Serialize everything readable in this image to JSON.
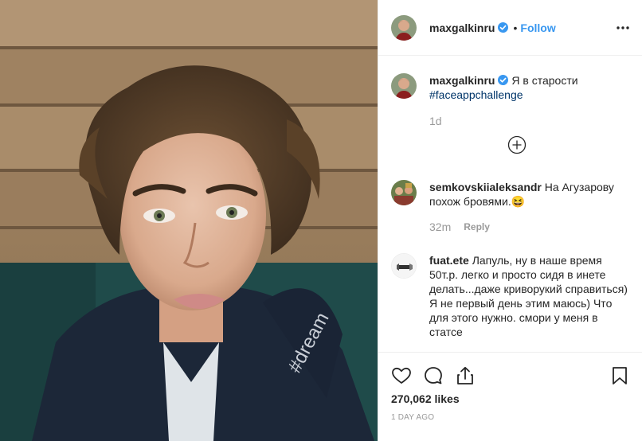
{
  "post": {
    "author": {
      "username": "maxgalkinru",
      "verified": true,
      "follow_label": "Follow",
      "separator": "•"
    },
    "caption": {
      "text": "Я в старости",
      "hashtag": "#faceappchallenge",
      "time": "1d"
    },
    "comments": [
      {
        "username": "semkovskiialeksandr",
        "text": "На Агузарову похож бровями.😆",
        "time": "32m",
        "reply_label": "Reply"
      },
      {
        "username": "fuat.ete",
        "text": "Лапуль, ну в наше время 50т.р. легко и просто сидя в инете делать...даже криворукий справиться) Я не первый день этим маюсь) Что для этого нужно. смори у меня в статсе"
      }
    ],
    "likes_label": "270,062 likes",
    "date_label": "1 DAY AGO",
    "hoodie_text": "#dream"
  },
  "colors": {
    "link_blue": "#3897f0",
    "hashtag_blue": "#003569",
    "muted_gray": "#999999",
    "text_dark": "#262626",
    "verified_badge": "#3897f0"
  },
  "icons": [
    "more-options-icon",
    "verified-badge-icon",
    "load-more-plus-icon",
    "heart-icon",
    "comment-icon",
    "share-icon",
    "bookmark-icon"
  ]
}
